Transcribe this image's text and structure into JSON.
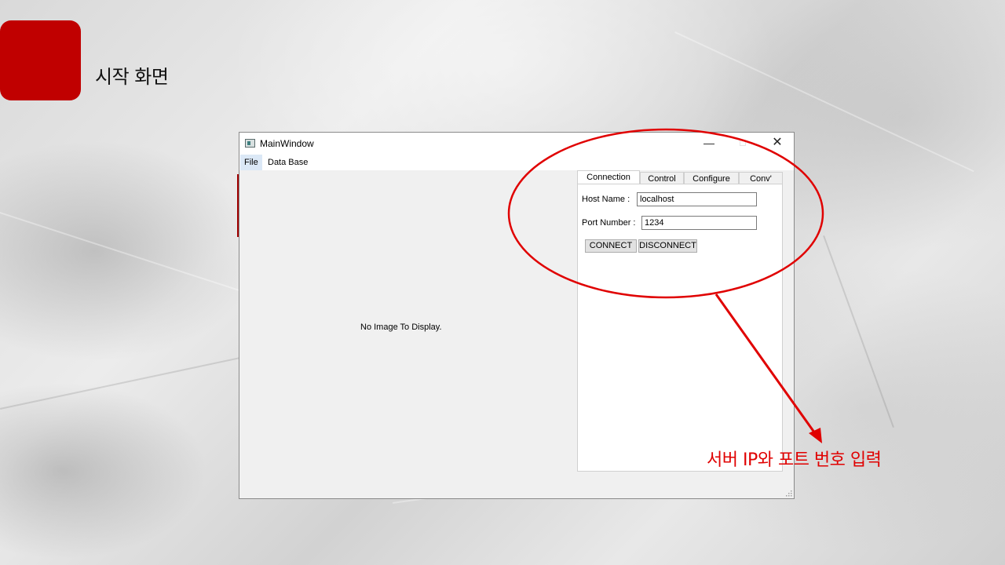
{
  "slide": {
    "title": "시작 화면",
    "annotation": "서버 IP와 포트 번호 입력",
    "accent_color": "#c00000",
    "annotation_color": "#e00000"
  },
  "window": {
    "title": "MainWindow",
    "controls": {
      "minimize": "—",
      "maximize": "□",
      "close": "✕"
    },
    "menu": {
      "file": "File",
      "database": "Data Base"
    },
    "image_area": {
      "message": "No Image To Display."
    },
    "tabs": [
      {
        "label": "Connection",
        "active": true
      },
      {
        "label": "Control",
        "active": false
      },
      {
        "label": "Configure",
        "active": false
      },
      {
        "label": "Conv'",
        "active": false
      }
    ],
    "connection": {
      "host_label": "Host Name :",
      "host_value": "localhost",
      "port_label": "Port Number :",
      "port_value": "1234",
      "connect_label": "CONNECT",
      "disconnect_label": "DISCONNECT"
    }
  },
  "icons": [
    "app-window-icon",
    "minimize-icon",
    "maximize-icon",
    "close-icon",
    "resize-grip-icon",
    "annotation-arrow-icon"
  ]
}
